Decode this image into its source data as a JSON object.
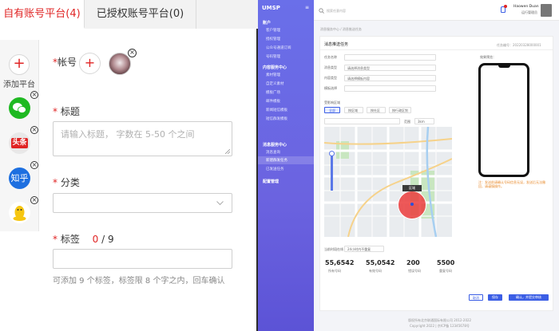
{
  "left": {
    "tabs": {
      "own": "自有账号平台(4)",
      "authorized": "已授权账号平台(0)"
    },
    "platforms": {
      "add_label": "添加平台",
      "toutiao": "头条",
      "zhihu": "知乎"
    },
    "account": {
      "label": "帐号"
    },
    "title": {
      "label": "标题",
      "placeholder": "请输入标题， 字数在 5-50 个之间"
    },
    "category": {
      "label": "分类"
    },
    "tags": {
      "label": "标签",
      "count": "0",
      "separator": "/",
      "max": "9",
      "hint": "可添加 9 个标签，标签限 8 个字之内，回车确认"
    }
  },
  "right": {
    "app_title": "UMSP",
    "search_placeholder": "搜索任意内容",
    "user": {
      "name": "Haowen Duan",
      "role": "运行管理员"
    },
    "sidebar": {
      "sections": [
        {
          "title": "账户",
          "items": [
            "客户管理",
            "授权管理",
            "公众号通道订阅",
            "号码管理"
          ]
        },
        {
          "title": "内容服务中心",
          "items": [
            "素材管理",
            "自定义素材",
            "模板广场",
            "邮件模板",
            "新闻短信模板",
            "短信群发模板"
          ]
        },
        {
          "title": "消息服务中心",
          "items": [
            "消息查询",
            "新建群发任务",
            "已发送任务"
          ]
        },
        {
          "title": "配置管理",
          "items": []
        }
      ]
    },
    "breadcrumb": "消息服务中心 / 消息推送任务",
    "card_title": "消息推送任务",
    "task_no": "任务编号：20220328000001",
    "form": {
      "task_name": "任务名称",
      "msg_type": "消息类型",
      "msg_type_val": "请选择消息类型",
      "content_type": "内容类型",
      "content_type_val": "请选择模板内容",
      "content_template": "模板选择",
      "region_label": "受影响区域",
      "chips": [
        "全部",
        "按区域",
        "按社区",
        "按行政区划"
      ],
      "range_label": "范围",
      "range_val": "3km",
      "preview_label": "效果预览：",
      "map_tag": "区域",
      "time_label": "当前时段在线",
      "time_val": "24小时内不重复"
    },
    "stats": [
      {
        "value": "55,6542",
        "label": "所有号码"
      },
      {
        "value": "55,0542",
        "label": "有效号码"
      },
      {
        "value": "200",
        "label": "错误号码"
      },
      {
        "value": "5500",
        "label": "重复号码"
      }
    ],
    "note": "注：发送前请确认号码信息无误，发送后无法撤回，请谨慎操作。",
    "buttons": {
      "cancel": "取消",
      "draft": "保存",
      "submit": "确认，并提交审核"
    },
    "footer1": "版权所有北京联通国际有限公司 2012-2022",
    "footer2": "Copyright 2022 | 京ICP备 12345678号"
  },
  "colors": {
    "brand_red": "#e02424",
    "sidebar_purple": "#6a6fe9",
    "primary_blue": "#3b5ee5"
  }
}
